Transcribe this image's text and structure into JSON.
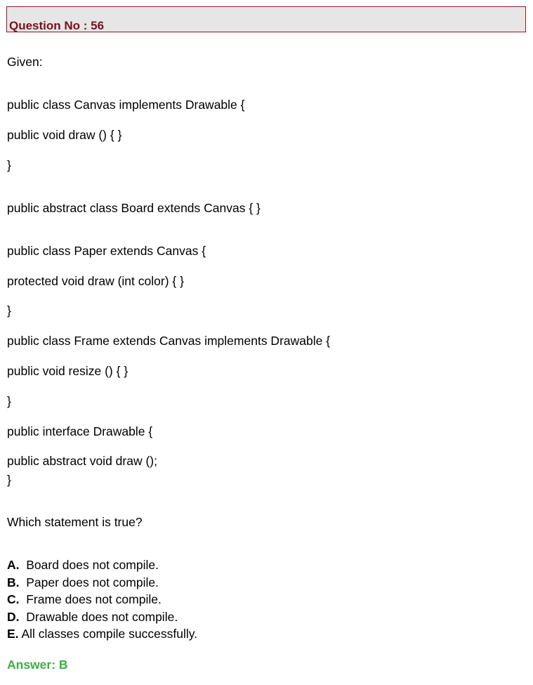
{
  "header": {
    "title": "Question No : 56"
  },
  "intro": "Given:",
  "code_lines": [
    "public class Canvas implements Drawable {",
    "public void draw () { }",
    "}",
    "public abstract class Board extends Canvas { }",
    "public class Paper extends Canvas {",
    "protected void draw (int color) { }",
    "}",
    "public class Frame extends Canvas implements Drawable {",
    "public void resize () { }",
    "}",
    "public interface Drawable {",
    "public abstract void draw ();",
    "}"
  ],
  "question": "Which statement is true?",
  "options": [
    {
      "letter": "A.",
      "text": "Board does not compile."
    },
    {
      "letter": "B.",
      "text": "Paper does not compile."
    },
    {
      "letter": "C.",
      "text": "Frame does not compile."
    },
    {
      "letter": "D.",
      "text": "Drawable does not compile."
    },
    {
      "letter": "E.",
      "text": "All classes compile successfully."
    }
  ],
  "answer": "Answer: B"
}
